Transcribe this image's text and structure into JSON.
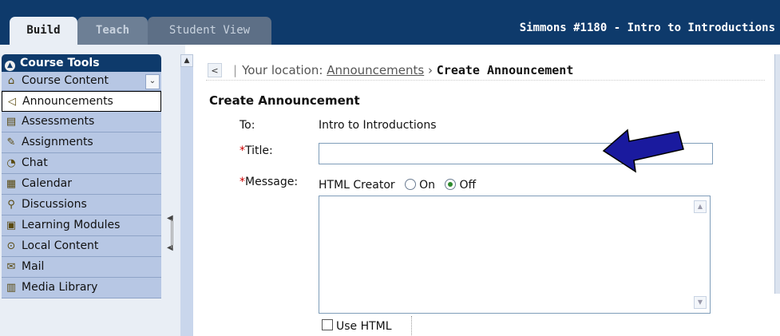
{
  "header": {
    "tabs": [
      {
        "label": "Build",
        "active": true
      },
      {
        "label": "Teach",
        "active": false
      },
      {
        "label": "Student View",
        "active": false
      }
    ],
    "course_title": "Simmons #1180 - Intro to Introductions"
  },
  "sidebar": {
    "title": "Course Tools",
    "items": [
      {
        "label": "Course Content",
        "icon": "house-icon"
      },
      {
        "label": "Announcements",
        "icon": "megaphone-icon",
        "selected": true
      },
      {
        "label": "Assessments",
        "icon": "clipboard-icon"
      },
      {
        "label": "Assignments",
        "icon": "pencil-icon"
      },
      {
        "label": "Chat",
        "icon": "speech-bubble-icon"
      },
      {
        "label": "Calendar",
        "icon": "calendar-icon"
      },
      {
        "label": "Discussions",
        "icon": "pushpin-icon"
      },
      {
        "label": "Learning Modules",
        "icon": "document-icon"
      },
      {
        "label": "Local Content",
        "icon": "disc-icon"
      },
      {
        "label": "Mail",
        "icon": "envelope-icon"
      },
      {
        "label": "Media Library",
        "icon": "media-icon"
      }
    ]
  },
  "location": {
    "prefix": "Your location:",
    "link": "Announcements",
    "current": "Create Announcement"
  },
  "form": {
    "heading": "Create Announcement",
    "to_label": "To:",
    "to_value": "Intro to Introductions",
    "required_marker": "*",
    "title_label": "Title:",
    "title_value": "",
    "message_label": "Message:",
    "html_creator_label": "HTML Creator",
    "option_on": "On",
    "option_off": "Off",
    "html_creator_selected": "Off",
    "use_html_label": "Use HTML",
    "use_html_checked": false
  },
  "colors": {
    "header_bg": "#0e3a6b",
    "sidebar_item_bg": "#b7c7e4",
    "required": "#cc0000",
    "pointer_arrow": "#1a1a9e"
  }
}
